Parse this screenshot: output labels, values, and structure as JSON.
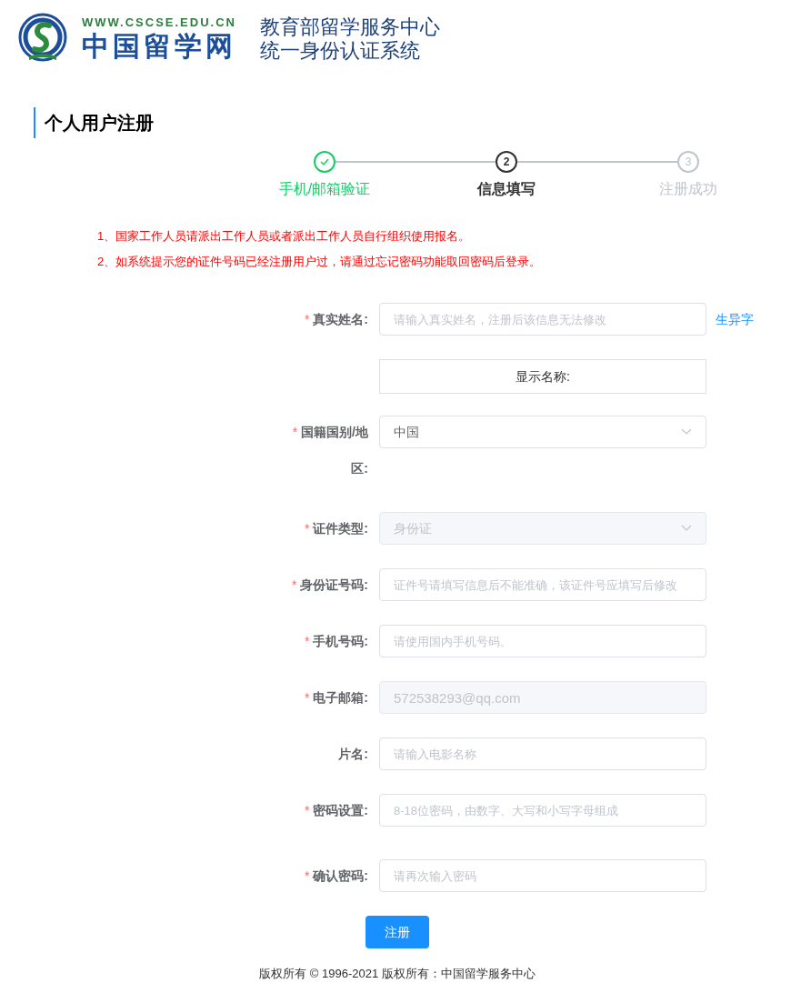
{
  "header": {
    "site_url": "WWW.CSCSE.EDU.CN",
    "site_name": "中国留学网",
    "org": "教育部留学服务中心",
    "system": "统一身份认证系统"
  },
  "page_title": "个人用户注册",
  "steps": [
    {
      "label": "手机/邮箱验证",
      "completed": true,
      "selected": false
    },
    {
      "number": "2",
      "label": "信息填写",
      "completed": false,
      "selected": true
    },
    {
      "number": "3",
      "label": "注册成功",
      "completed": false,
      "selected": false
    }
  ],
  "notices": [
    "1、国家工作人员请派出工作人员或者派出工作人员自行组织使用报名。",
    "2、如系统提示您的证件号码已经注册用户过，请通过忘记密码功能取回密码后登录。"
  ],
  "fields": [
    {
      "kind": "input",
      "required_mark": "*",
      "label": "真实姓名:",
      "placeholder": "请输入真实姓名，注册后该信息无法修改",
      "link": "生异字"
    },
    {
      "kind": "display",
      "text": "显示名称:"
    },
    {
      "kind": "select",
      "required_mark": "*",
      "label": "国籍国别/地区:",
      "value": "中国"
    },
    {
      "kind": "select",
      "required_mark": "*",
      "label": "证件类型:",
      "value": "身份证",
      "disabled": true
    },
    {
      "kind": "input",
      "required_mark": "*",
      "label": "身份证号码:",
      "placeholder": "证件号请填写信息后不能准确，该证件号应填写后修改"
    },
    {
      "kind": "input",
      "required_mark": "*",
      "label": "手机号码:",
      "placeholder": "请使用国内手机号码。"
    },
    {
      "kind": "input",
      "required_mark": "*",
      "label": "电子邮箱:",
      "value": "572538293@qq.com",
      "disabled": true
    },
    {
      "kind": "input",
      "label": "片名:",
      "placeholder": "请输入电影名称"
    },
    {
      "kind": "input",
      "required_mark": "*",
      "label": "密码设置:",
      "placeholder": "8-18位密码，由数字、大写和小写字母组成"
    },
    {
      "kind": "input",
      "required_mark": "*",
      "label": "确认密码:",
      "placeholder": "请再次输入密码"
    }
  ],
  "submit": "注册",
  "footer": "版权所有 © 1996-2021 版权所有：中国留学服务中心"
}
